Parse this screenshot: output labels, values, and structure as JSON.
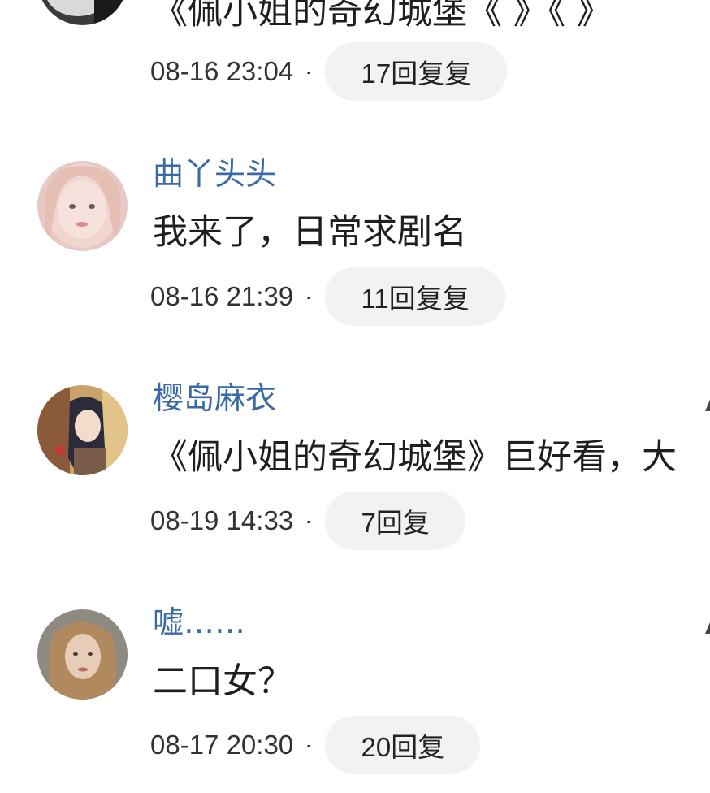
{
  "comments": [
    {
      "id": "c0",
      "username": "",
      "content": "《佩小姐的奇幻城堡《 》《 》",
      "timestamp": "08-16 23:04",
      "reply_label": "17回复复",
      "avatar_icon": "avatar-dark-portrait"
    },
    {
      "id": "c1",
      "username": "曲丫头头",
      "content": "我来了，日常求剧名",
      "timestamp": "08-16 21:39",
      "reply_label": "11回复复",
      "avatar_icon": "avatar-girl-pink"
    },
    {
      "id": "c2",
      "username": "樱岛麻衣",
      "content": "《佩小姐的奇幻城堡》巨好看，大",
      "timestamp": "08-19 14:33",
      "reply_label": "7回复",
      "avatar_icon": "avatar-anime-girl"
    },
    {
      "id": "c3",
      "username": "嘘……",
      "content": "二口女？",
      "timestamp": "08-17 20:30",
      "reply_label": "20回复",
      "avatar_icon": "avatar-woman-blonde"
    }
  ],
  "separator_dot": "·",
  "colors": {
    "username": "#3a6aa5",
    "content": "#1f1f1f",
    "reply_bg": "#f2f2f2"
  }
}
